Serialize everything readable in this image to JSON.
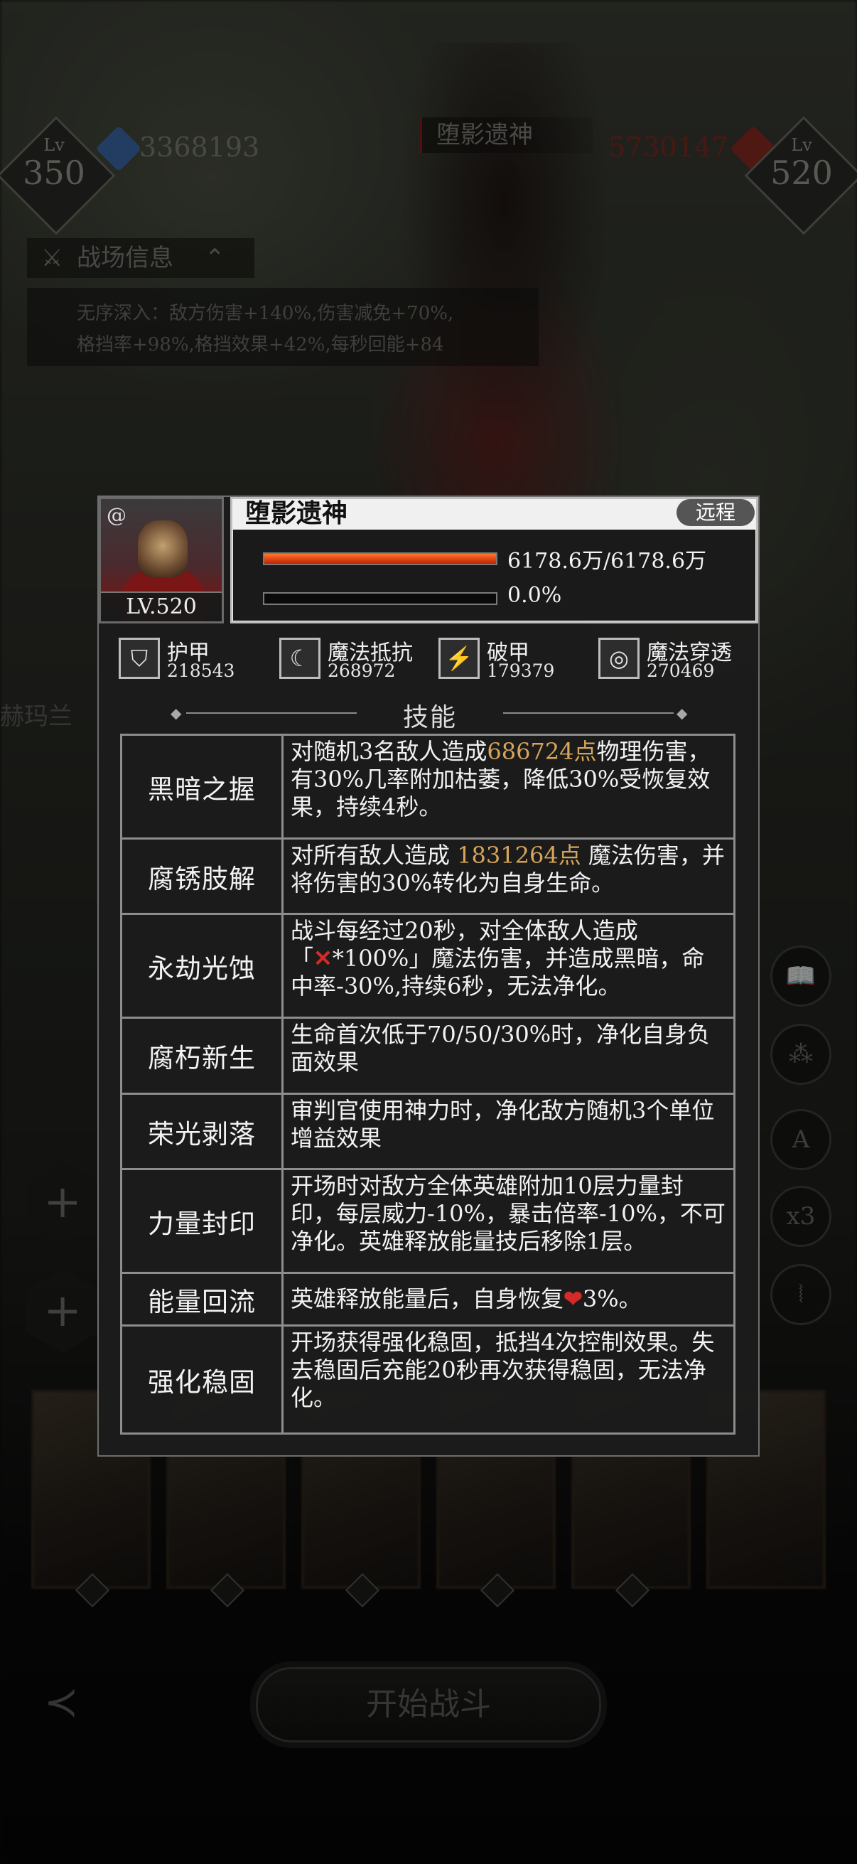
{
  "hud": {
    "player_level_tag": "Lv",
    "player_level": "350",
    "player_power": "3368193",
    "enemy_level_tag": "Lv",
    "enemy_level": "520",
    "enemy_power": "5730147",
    "boss_name": "堕影遗神",
    "battle_info_tab": "战场信息",
    "battle_info_line1": "无序深入：敌方伤害+140%,伤害减免+70%,",
    "battle_info_line2": "格挡率+98%,格挡效果+42%,每秒回能+84"
  },
  "side": {
    "left_label": "赫玛兰",
    "plus": "+",
    "right_buttons": [
      "📖",
      "⁂",
      "A",
      "x3",
      "⦚"
    ]
  },
  "bottom": {
    "start_button": "开始战斗",
    "back_icon": "≺"
  },
  "boss": {
    "name": "堕影遗神",
    "type": "远程",
    "level": "LV.520",
    "hp_text": "6178.6万/6178.6万",
    "hp_fraction": 1.0,
    "energy_text": "0.0%",
    "energy_fraction": 0.0
  },
  "stats": [
    {
      "name": "护甲",
      "value": "218543",
      "icon": "armor-icon"
    },
    {
      "name": "魔法抵抗",
      "value": "268972",
      "icon": "magic-resist-icon"
    },
    {
      "name": "破甲",
      "value": "179379",
      "icon": "armor-break-icon"
    },
    {
      "name": "魔法穿透",
      "value": "270469",
      "icon": "magic-pen-icon"
    }
  ],
  "skills_title": "技能",
  "skills": [
    {
      "name": "黑暗之握",
      "desc_pre": "对随机3名敌人造成",
      "highlight": "686724点",
      "desc_post": "物理伤害，有30%几率附加枯萎，降低30%受恢复效果，持续4秒。"
    },
    {
      "name": "腐锈肢解",
      "desc_pre": "对所有敌人造成 ",
      "highlight": "1831264点",
      "desc_post": " 魔法伤害，并将伤害的30%转化为自身生命。"
    },
    {
      "name": "永劫光蚀",
      "desc_pre": "战斗每经过20秒，对全体敌人造成「",
      "icon": "✕",
      "desc_post": "*100%」魔法伤害，并造成黑暗，命中率-30%,持续6秒，无法净化。"
    },
    {
      "name": "腐朽新生",
      "desc": "生命首次低于70/50/30%时，净化自身负面效果"
    },
    {
      "name": "荣光剥落",
      "desc": "审判官使用神力时，净化敌方随机3个单位增益效果"
    },
    {
      "name": "力量封印",
      "desc": "开场时对敌方全体英雄附加10层力量封印，每层威力-10%，暴击倍率-10%，不可净化。英雄释放能量技后移除1层。"
    },
    {
      "name": "能量回流",
      "desc_pre": "英雄释放能量后，自身恢复",
      "icon": "❤",
      "desc_post": "3%。"
    },
    {
      "name": "强化稳固",
      "desc": "开场获得强化稳固，抵挡4次控制效果。失去稳固后充能20秒再次获得稳固，无法净化。"
    }
  ]
}
